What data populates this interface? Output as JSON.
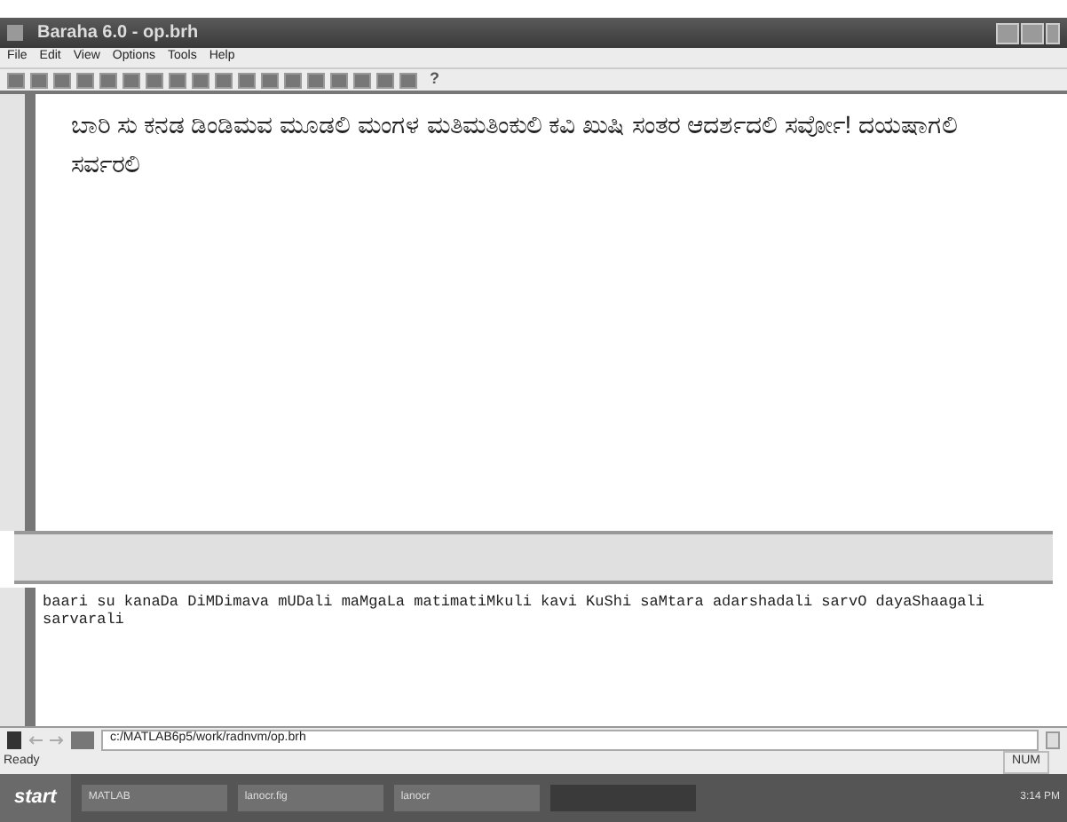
{
  "window": {
    "title": "Baraha 6.0 - op.brh"
  },
  "menu": [
    "File",
    "Edit",
    "View",
    "Options",
    "Tools",
    "Help"
  ],
  "toolbar": {
    "help_glyph": "?"
  },
  "editor": {
    "text": "ಬಾರಿ ಸು ಕನಡ ಡಿಂಡಿಮವ ಮೂಡಲಿ ಮಂಗಳ ಮತಿಮತಿಂಕುಲಿ ಕವಿ ಖುಷಿ ಸಂತರ ಆದರ್ಶದಲಿ ಸರ್ವೋ! ದಯಷಾಗಲಿ ಸರ್ವರಲಿ"
  },
  "transliteration": {
    "text": "baari su kanaDa DiMDimava mUDali maMgaLa matimatiMkuli kavi KuShi saMtara adarshadali sarvO dayaShaagali sarvarali"
  },
  "address_bar": {
    "value": "c:/MATLAB6p5/work/radnvm/op.brh"
  },
  "status_bar": {
    "message": "Ready",
    "indicator": "NUM"
  },
  "taskbar": {
    "start": "start",
    "items": [
      {
        "label": "MATLAB",
        "selected": false
      },
      {
        "label": "lanocr.fig",
        "selected": false
      },
      {
        "label": "lanocr",
        "selected": false
      },
      {
        "selected": true
      }
    ],
    "clock": "3:14 PM"
  }
}
